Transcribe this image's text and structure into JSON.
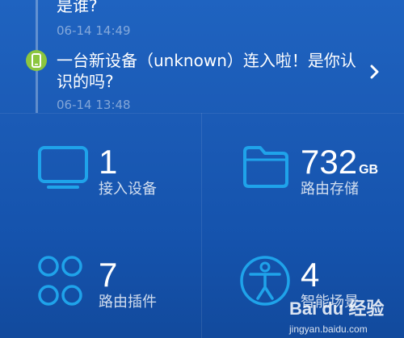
{
  "notifications": [
    {
      "title": "是谁?",
      "time": "06-14 14:49"
    },
    {
      "title": "一台新设备（unknown）连入啦！是你认识的吗?",
      "time": "06-14 13:48"
    }
  ],
  "stats": {
    "devices": {
      "value": "1",
      "label": "接入设备",
      "icon": "monitor-icon"
    },
    "storage": {
      "value": "732",
      "unit": "GB",
      "label": "路由存储",
      "icon": "folder-icon"
    },
    "plugins": {
      "value": "7",
      "label": "路由插件",
      "icon": "plugins-grid-icon"
    },
    "smart": {
      "value": "4",
      "label": "智能场景",
      "icon": "person-icon"
    }
  },
  "watermark": {
    "logo": "Bai du 经验",
    "url": "jingyan.baidu.com"
  },
  "colors": {
    "background": "#1b5bb6",
    "icon_accent": "#1fa3ea",
    "badge": "#8cc63f"
  }
}
